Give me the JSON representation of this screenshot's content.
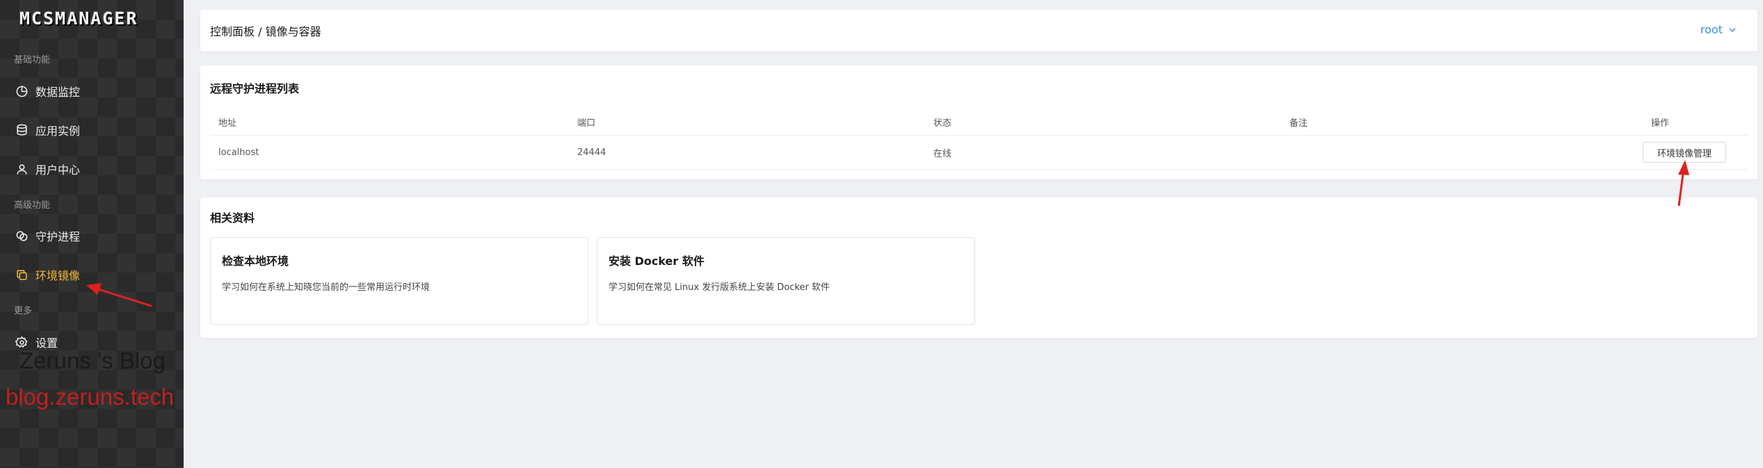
{
  "sidebar": {
    "logo": "MCSMANAGER",
    "groups": [
      {
        "label": "基础功能"
      },
      {
        "label": "高级功能"
      },
      {
        "label": "更多"
      }
    ],
    "items": [
      {
        "label": "数据监控",
        "icon": "pie-chart-icon"
      },
      {
        "label": "应用实例",
        "icon": "database-icon"
      },
      {
        "label": "用户中心",
        "icon": "user-icon"
      },
      {
        "label": "守护进程",
        "icon": "link-icon"
      },
      {
        "label": "环境镜像",
        "icon": "copy-icon"
      },
      {
        "label": "设置",
        "icon": "gear-icon"
      }
    ],
    "active_color": "#f0b43a",
    "watermark_line1": "Zeruns 's Blog",
    "watermark_line2": "blog.zeruns.tech"
  },
  "header": {
    "breadcrumb": "控制面板 / 镜像与容器",
    "user": "root"
  },
  "daemons": {
    "title": "远程守护进程列表",
    "columns": [
      "地址",
      "端口",
      "状态",
      "备注",
      "操作"
    ],
    "rows": [
      {
        "address": "localhost",
        "port": "24444",
        "status": "在线",
        "remark": "",
        "action": "环境镜像管理"
      }
    ]
  },
  "docs": {
    "title": "相关资料",
    "cards": [
      {
        "title": "检查本地环境",
        "desc": "学习如何在系统上知晓您当前的一些常用运行时环境"
      },
      {
        "title": "安装 Docker 软件",
        "desc": "学习如何在常见 Linux 发行版系统上安装 Docker 软件"
      }
    ]
  },
  "colors": {
    "accent": "#3a8ee6",
    "annotation": "#e02020"
  }
}
